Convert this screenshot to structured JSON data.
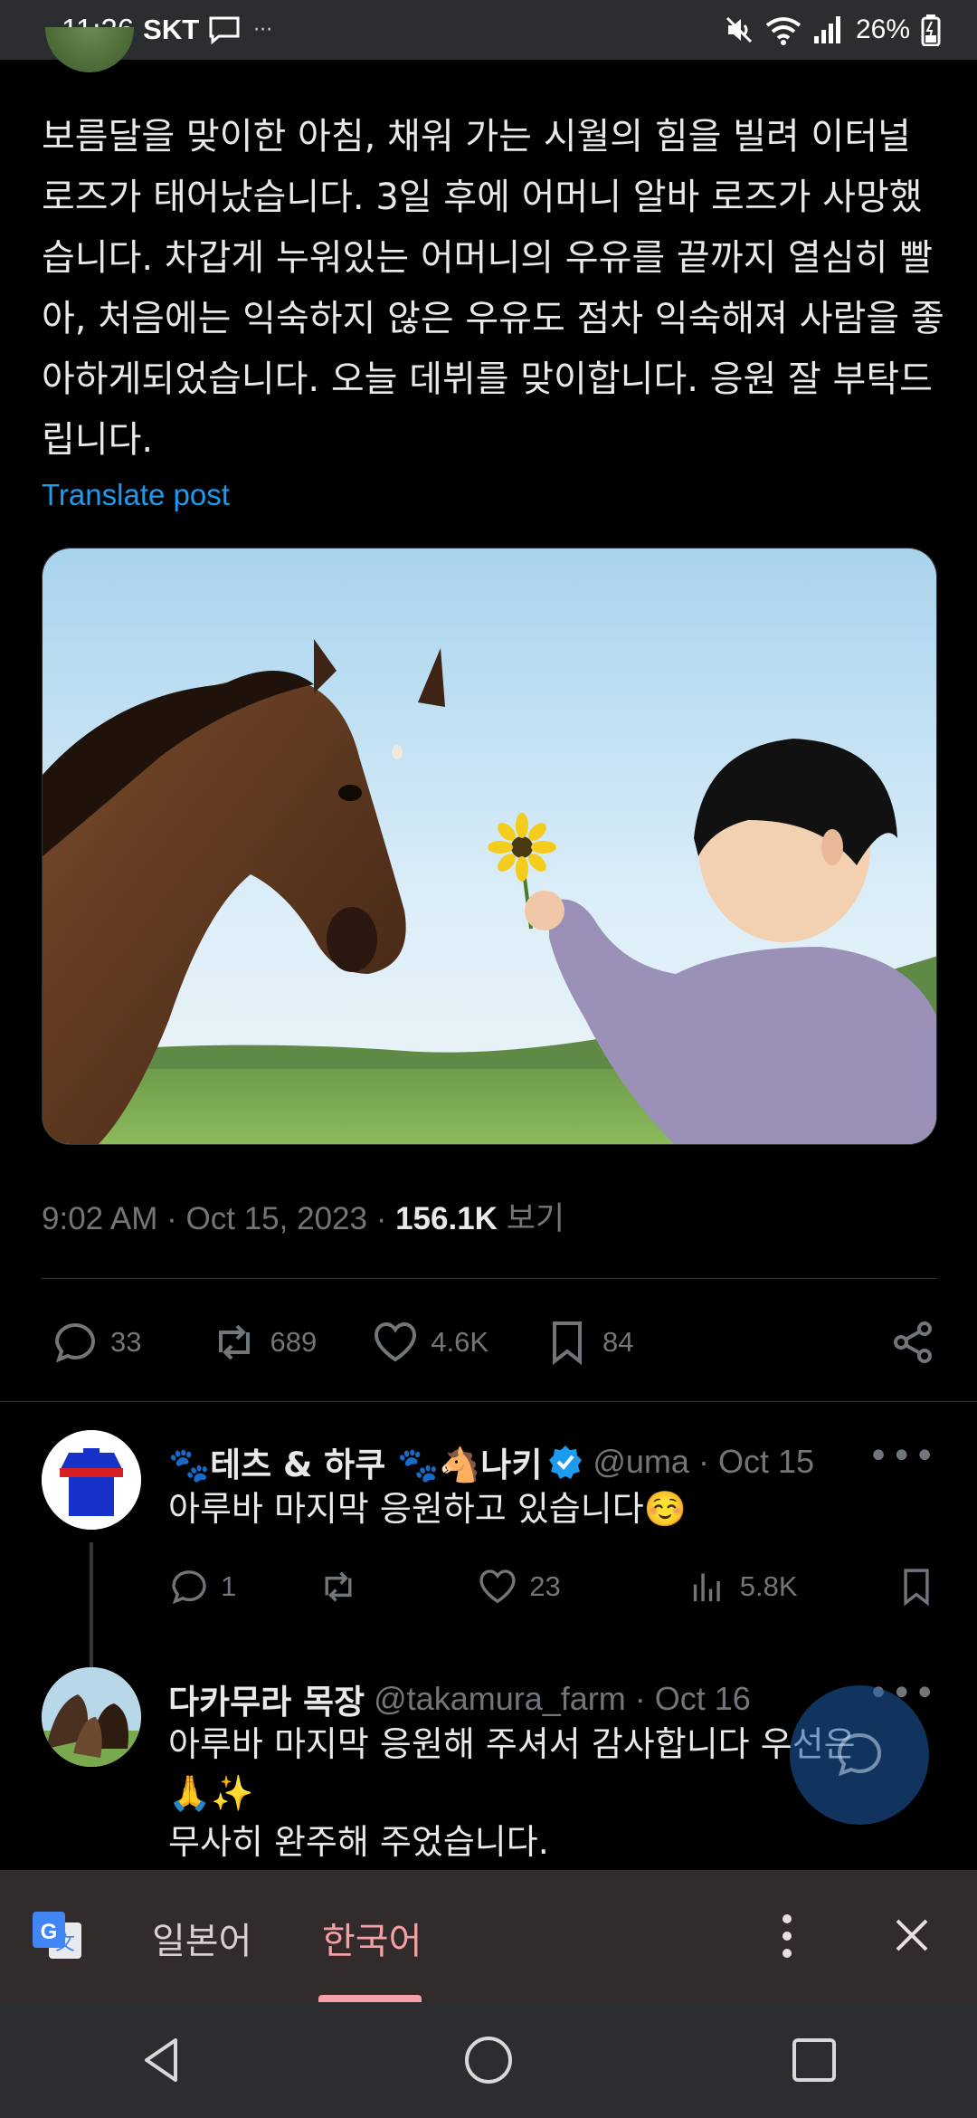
{
  "status_bar": {
    "time": "11:26",
    "carrier": "SKT",
    "battery": "26%"
  },
  "post": {
    "text": "보름달을 맞이한 아침, 채워 가는 시월의 힘을 빌려 이터널 로즈가 태어났습니다. 3일 후에 어머니 알바 로즈가 사망했습니다. 차갑게 누워있는 어머니의 우유를 끝까지 열심히 빨아, 처음에는 익숙하지 않은 우유도 점차 익숙해져 사람을 좋아하게되었습니다. 오늘 데뷔를 맞이합니다. 응원 잘 부탁드립니다.",
    "translate_label": "Translate post",
    "time": "9:02 AM",
    "date": "Oct 15, 2023",
    "views": "156.1K",
    "views_label": "보기",
    "stats": {
      "replies": "33",
      "reposts": "689",
      "likes": "4.6K",
      "bookmarks": "84"
    }
  },
  "replies": [
    {
      "name": "🐾테츠 & 하쿠 🐾🐴나키",
      "handle": "@uma",
      "date": "Oct 15",
      "text": "아루바 마지막 응원하고 있습니다☺️",
      "replies": "1",
      "reposts": "",
      "likes": "23",
      "views": "5.8K"
    },
    {
      "name": "다카무라 목장",
      "handle": "@takamura_farm",
      "date": "Oct 16",
      "text_line1": "아루바 마지막 응원해 주셔서 감사합니다 우선은",
      "text_line2": "🙏✨",
      "text_line3": "무사히 완주해 주었습니다."
    }
  ],
  "translate_bar": {
    "source_lang": "일본어",
    "target_lang": "한국어"
  },
  "colors": {
    "accent": "#1d9bf0",
    "muted": "#71767b",
    "translate_active": "#f5a0a6"
  }
}
